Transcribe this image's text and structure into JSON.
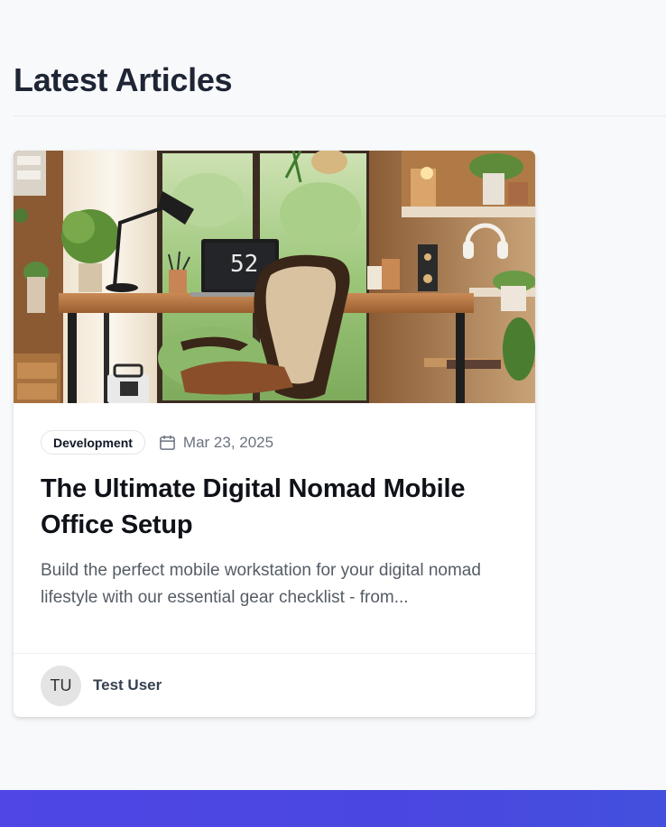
{
  "section": {
    "title": "Latest Articles"
  },
  "article": {
    "category": "Development",
    "date": "Mar 23, 2025",
    "title": "The Ultimate Digital Nomad Mobile Office Setup",
    "excerpt": "Build the perfect mobile workstation for your digital nomad lifestyle with our essential gear checklist - from...",
    "laptop_screen_text": "52",
    "author": {
      "initials": "TU",
      "name": "Test User"
    }
  },
  "colors": {
    "title": "#1e2535",
    "footer_band": "#4f46e5",
    "pill_border": "#e2e4e8"
  }
}
